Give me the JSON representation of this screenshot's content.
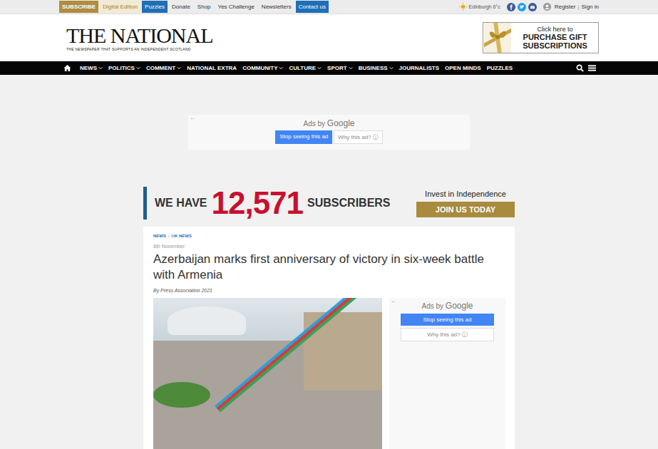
{
  "topbar": {
    "links": [
      {
        "label": "SUBSCRIBE",
        "kind": "gold"
      },
      {
        "label": "Digital Edition",
        "kind": "light"
      },
      {
        "label": "Puzzles",
        "kind": "blue"
      },
      {
        "label": "Donate",
        "kind": "plain"
      },
      {
        "label": "Shop",
        "kind": "plain"
      },
      {
        "label": "Yes Challenge",
        "kind": "plain"
      },
      {
        "label": "Newsletters",
        "kind": "plain"
      },
      {
        "label": "Contact us",
        "kind": "blue"
      }
    ],
    "weather": "Edinburgh 6°c",
    "account": {
      "register": "Register",
      "separator": "|",
      "signin": "Sign in"
    }
  },
  "logo": {
    "title": "THE NATIONAL",
    "tagline": "THE NEWSPAPER THAT SUPPORTS AN INDEPENDENT SCOTLAND"
  },
  "header_ad": {
    "intro": "Click here to",
    "lines": [
      "PURCHASE GIFT",
      "SUBSCRIPTIONS"
    ]
  },
  "nav": {
    "items": [
      {
        "label": "NEWS",
        "dropdown": true
      },
      {
        "label": "POLITICS",
        "dropdown": true
      },
      {
        "label": "COMMENT",
        "dropdown": true
      },
      {
        "label": "NATIONAL EXTRA",
        "dropdown": false
      },
      {
        "label": "COMMUNITY",
        "dropdown": true
      },
      {
        "label": "CULTURE",
        "dropdown": true
      },
      {
        "label": "SPORT",
        "dropdown": true
      },
      {
        "label": "BUSINESS",
        "dropdown": true
      },
      {
        "label": "JOURNALISTS",
        "dropdown": false
      },
      {
        "label": "OPEN MINDS",
        "dropdown": false
      },
      {
        "label": "PUZZLES",
        "dropdown": false
      }
    ]
  },
  "top_ad": {
    "back": "←",
    "ads_by": "Ads by",
    "google": "Google",
    "stop": "Stop seeing this ad",
    "why": "Why this ad?",
    "info": "ⓘ"
  },
  "subscribers": {
    "prefix": "WE HAVE",
    "count": "12,571",
    "suffix": "SUBSCRIBERS",
    "tagline": "Invest in Independence",
    "button": "JOIN US TODAY"
  },
  "article": {
    "categories": [
      "NEWS",
      "UK NEWS"
    ],
    "category_separator": "|",
    "date": "8th November",
    "title": "Azerbaijan marks first anniversary of victory in six-week battle with Armenia",
    "byline": "By Press Association 2021"
  },
  "side_ad": {
    "back": "←",
    "ads_by": "Ads by",
    "google": "Google",
    "stop": "Stop seeing this ad",
    "why": "Why this ad?",
    "info": "ⓘ"
  }
}
